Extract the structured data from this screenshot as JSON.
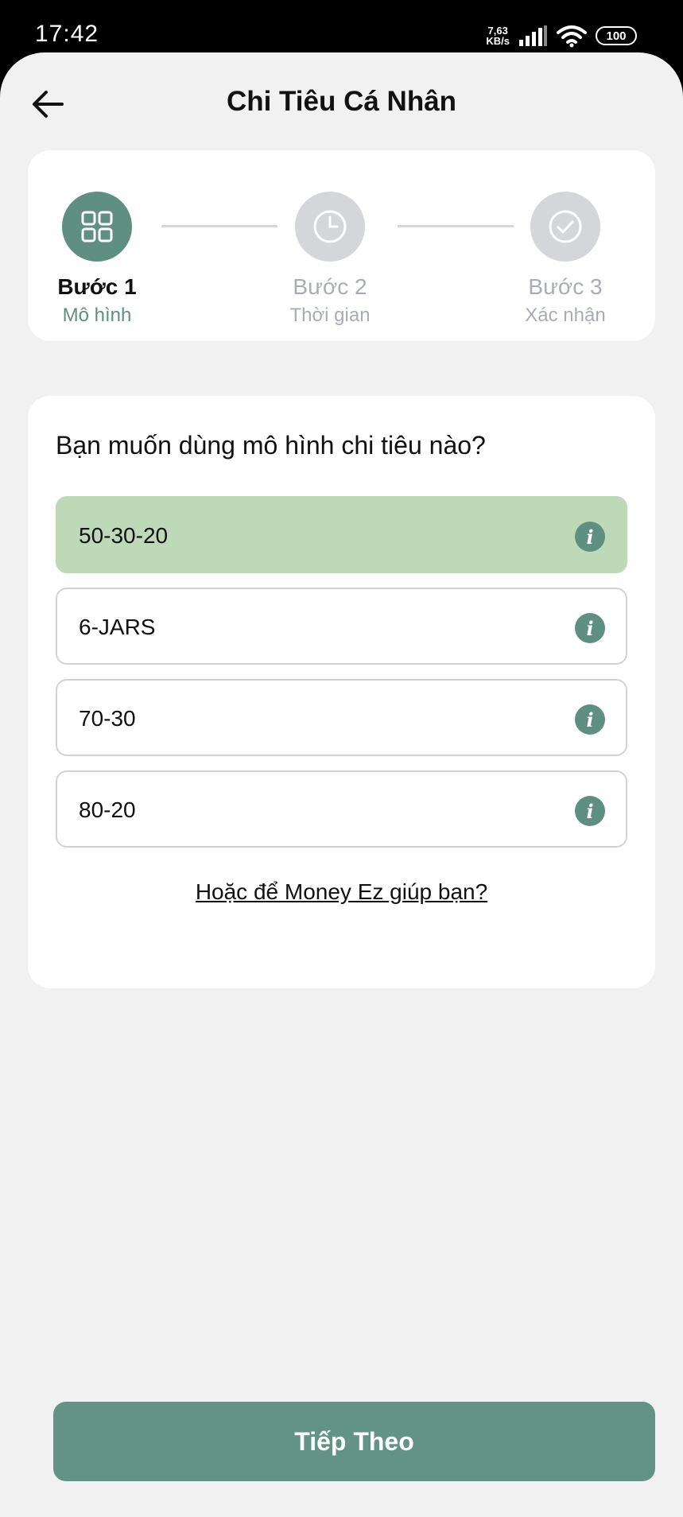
{
  "status_bar": {
    "time": "17:42",
    "net_speed_value": "7,63",
    "net_speed_unit": "KB/s",
    "battery": "100"
  },
  "header": {
    "title": "Chi Tiêu Cá Nhân",
    "back_icon": "arrow-left-icon"
  },
  "stepper": {
    "steps": [
      {
        "title": "Bước 1",
        "subtitle": "Mô hình",
        "icon": "grid-icon",
        "state": "active"
      },
      {
        "title": "Bước 2",
        "subtitle": "Thời gian",
        "icon": "clock-icon",
        "state": "inactive"
      },
      {
        "title": "Bước 3",
        "subtitle": "Xác nhận",
        "icon": "check-circle-icon",
        "state": "inactive"
      }
    ]
  },
  "model_selection": {
    "question": "Bạn muốn dùng mô hình chi tiêu nào?",
    "options": [
      {
        "label": "50-30-20",
        "selected": true
      },
      {
        "label": "6-JARS",
        "selected": false
      },
      {
        "label": "70-30",
        "selected": false
      },
      {
        "label": "80-20",
        "selected": false
      }
    ],
    "info_icon": "i",
    "help_link": "Hoặc để Money Ez giúp bạn?"
  },
  "footer": {
    "next_label": "Tiếp Theo"
  },
  "colors": {
    "accent": "#5f8f81",
    "selected_option": "#bdd9b8",
    "background": "#f1f1f1"
  }
}
